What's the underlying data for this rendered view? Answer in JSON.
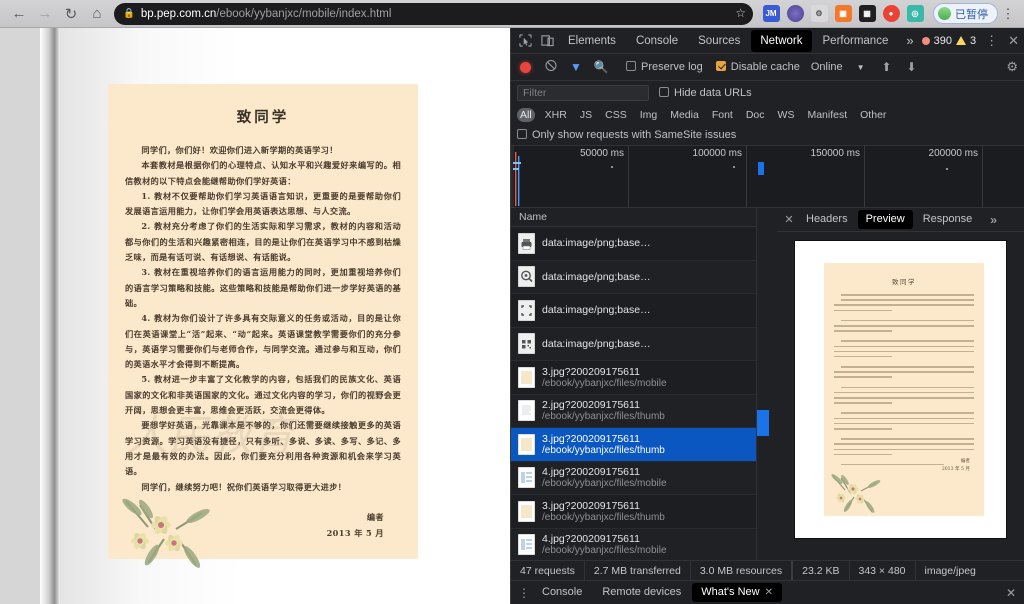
{
  "browser": {
    "back_icon": "back-arrow-icon",
    "forward_icon": "forward-arrow-icon",
    "reload_icon": "reload-icon",
    "home_icon": "home-icon",
    "lock_icon": "lock-icon",
    "url_host": "bp.pep.com.cn",
    "url_path": "/ebook/yybanjxc/mobile/index.html",
    "url_full": "bp.pep.com.cn/ebook/yybanjxc/mobile/index.html",
    "star_icon": "bookmark-star-icon",
    "extensions": [
      {
        "name": "jm-extension",
        "label": "JM",
        "color": "#3b5bd4"
      },
      {
        "name": "circle-extension",
        "label": "",
        "color": "#5a4f9e"
      },
      {
        "name": "gear-extension",
        "label": "",
        "color": "#cfcfd3"
      },
      {
        "name": "orange-grid-extension",
        "label": "",
        "color": "#f07b28"
      },
      {
        "name": "qrcode-extension",
        "label": "",
        "color": "#1f1f1f"
      },
      {
        "name": "red-dot-extension",
        "label": "",
        "color": "#e8453c"
      },
      {
        "name": "translate-extension",
        "label": "",
        "color": "#35b9a3"
      }
    ],
    "profile_label": "已暂停",
    "menu_icon": "chrome-menu-icon"
  },
  "page": {
    "title": "致同学",
    "paragraphs": [
      "同学们，你们好！欢迎你们进入新学期的英语学习！",
      "本套教材是根据你们的心理特点、认知水平和兴趣爱好来编写的。相信教材的以下特点会能继帮助你们学好英语：",
      "1. 教材不仅要帮助你们学习英语语言知识，更重要的是要帮助你们发展语言运用能力，让你们学会用英语表达思想、与人交流。",
      "2. 教材充分考虑了你们的生活实际和学习需求，教材的内容和活动都与你们的生活和兴趣紧密相连，目的是让你们在英语学习中不感到枯燥乏味，而是有话可说、有话想说、有话能说。",
      "3. 教材在重视培养你们的语言运用能力的同时，更加重视培养你们的语言学习策略和技能。这些策略和技能是帮助你们进一步学好英语的基础。",
      "4. 教材为你们设计了许多具有交际意义的任务或活动，目的是让你们在英语课堂上“活”起来、“动”起来。英语课堂教学需要你们的充分参与，英语学习需要你们与老师合作，与同学交流。通过参与和互动，你们的英语水平才会得到不断提高。",
      "5. 教材进一步丰富了文化教学的内容，包括我们的民族文化、英语国家的文化和非英语国家的文化。通过文化内容的学习，你们的视野会更开阔，思想会更丰富，思维会更活跃，交流会更得体。",
      "要想学好英语，光靠课本是不够的，你们还需要继续接触更多的英语学习资源。学习英语没有捷径，只有多听、多说、多读、多写、多记、多用才是最有效的办法。因此，你们要充分利用各种资源和机会来学习英语。",
      "同学们，继续努力吧！祝你们英语学习取得更大进步！"
    ],
    "signature": "编者",
    "date": "2013 年 5 月",
    "flower_icon": "flower-decoration-icon"
  },
  "devtools": {
    "inspect_icon": "inspect-element-icon",
    "device_icon": "device-toolbar-icon",
    "tabs": [
      {
        "label": "Elements",
        "active": false
      },
      {
        "label": "Console",
        "active": false
      },
      {
        "label": "Sources",
        "active": false
      },
      {
        "label": "Network",
        "active": true
      },
      {
        "label": "Performance",
        "active": false
      }
    ],
    "more_tabs": "»",
    "error_count": "390",
    "warning_count": "3",
    "kebab_icon": "more-options-icon",
    "close_icon": "close-devtools-icon",
    "network_toolbar": {
      "record_icon": "record-stop-icon",
      "clear_icon": "clear-requests-icon",
      "filter_icon": "filter-funnel-icon",
      "search_icon": "search-icon",
      "preserve_log": {
        "label": "Preserve log",
        "checked": false
      },
      "disable_cache": {
        "label": "Disable cache",
        "checked": true
      },
      "throttle_value": "Online",
      "dropdown_icon": "chevron-down-icon",
      "import_icon": "import-har-icon",
      "export_icon": "export-har-icon",
      "settings_icon": "gear-icon"
    },
    "filter": {
      "placeholder": "Filter",
      "value": "",
      "hide_data_urls": {
        "label": "Hide data URLs",
        "checked": false
      },
      "types": [
        {
          "label": "All",
          "active": true
        },
        {
          "label": "XHR",
          "active": false
        },
        {
          "label": "JS",
          "active": false
        },
        {
          "label": "CSS",
          "active": false
        },
        {
          "label": "Img",
          "active": false
        },
        {
          "label": "Media",
          "active": false
        },
        {
          "label": "Font",
          "active": false
        },
        {
          "label": "Doc",
          "active": false
        },
        {
          "label": "WS",
          "active": false
        },
        {
          "label": "Manifest",
          "active": false
        },
        {
          "label": "Other",
          "active": false
        }
      ],
      "samesite": {
        "label": "Only show requests with SameSite issues",
        "checked": false
      }
    },
    "overview": {
      "ticks": [
        "50000 ms",
        "100000 ms",
        "150000 ms",
        "200000 ms"
      ]
    },
    "requests": {
      "column_header": "Name",
      "rows": [
        {
          "name": "data:image/png;base…",
          "path": "",
          "icon": "print-thumb-icon",
          "selected": false
        },
        {
          "name": "data:image/png;base…",
          "path": "",
          "icon": "zoom-thumb-icon",
          "selected": false
        },
        {
          "name": "data:image/png;base…",
          "path": "",
          "icon": "fullscreen-thumb-icon",
          "selected": false
        },
        {
          "name": "data:image/png;base…",
          "path": "",
          "icon": "qrcode-thumb-icon",
          "selected": false
        },
        {
          "name": "3.jpg?200209175611",
          "path": "/ebook/yybanjxc/files/mobile",
          "icon": "image-thumb-icon",
          "selected": false
        },
        {
          "name": "2.jpg?200209175611",
          "path": "/ebook/yybanjxc/files/thumb",
          "icon": "image-thumb-icon",
          "selected": false
        },
        {
          "name": "3.jpg?200209175611",
          "path": "/ebook/yybanjxc/files/thumb",
          "icon": "image-thumb-icon",
          "selected": true
        },
        {
          "name": "4.jpg?200209175611",
          "path": "/ebook/yybanjxc/files/mobile",
          "icon": "image-thumb-icon",
          "selected": false
        },
        {
          "name": "3.jpg?200209175611",
          "path": "/ebook/yybanjxc/files/thumb",
          "icon": "image-thumb-icon",
          "selected": false
        },
        {
          "name": "4.jpg?200209175611",
          "path": "/ebook/yybanjxc/files/mobile",
          "icon": "image-thumb-icon",
          "selected": false
        }
      ]
    },
    "detail": {
      "close_icon": "close-detail-icon",
      "tabs": [
        {
          "label": "Headers",
          "active": false
        },
        {
          "label": "Preview",
          "active": true
        },
        {
          "label": "Response",
          "active": false
        }
      ],
      "more_tabs": "»",
      "preview_title": "致同学",
      "preview_sign": "编者",
      "preview_date": "2013 年 5 月"
    },
    "status": {
      "requests": "47 requests",
      "transferred": "2.7 MB transferred",
      "resources": "3.0 MB resources",
      "size": "23.2 KB",
      "dimensions": "343 × 480",
      "mime": "image/jpeg"
    },
    "drawer": {
      "kebab_icon": "drawer-more-icon",
      "tabs": [
        {
          "label": "Console",
          "active": false,
          "closable": false
        },
        {
          "label": "Remote devices",
          "active": false,
          "closable": false
        },
        {
          "label": "What's New",
          "active": true,
          "closable": true
        }
      ],
      "close_icon": "close-drawer-icon"
    }
  },
  "colors": {
    "accent_blue": "#1a73e8",
    "selected_row": "#0b57c2",
    "devtools_bg": "#202124",
    "error_red": "#f28b82",
    "warn_yellow": "#fdd663",
    "paper": "#fce8cb"
  }
}
